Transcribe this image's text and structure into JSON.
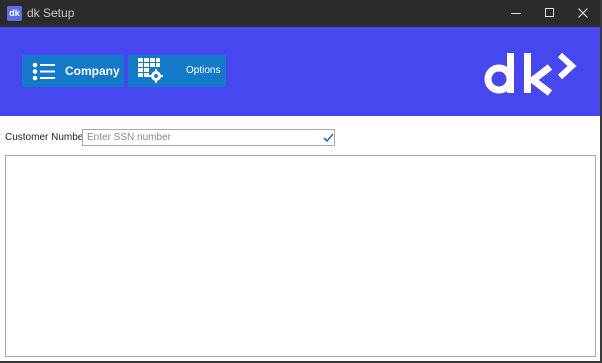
{
  "window": {
    "title": "dk Setup",
    "app_icon_text": "dk"
  },
  "banner": {
    "background_color": "#4747f0",
    "nav": [
      {
        "label": "Company",
        "icon": "list-icon",
        "selected": true
      },
      {
        "label": "Options",
        "icon": "grid-settings-icon",
        "selected": false
      }
    ],
    "logo": "dk-logo"
  },
  "form": {
    "customer_number_label": "Customer Number",
    "customer_number_value": "",
    "customer_number_placeholder": "Enter SSN number",
    "valid_indicator": "check-icon"
  },
  "colors": {
    "nav_button": "#1479c9",
    "check": "#1f6fd1"
  }
}
